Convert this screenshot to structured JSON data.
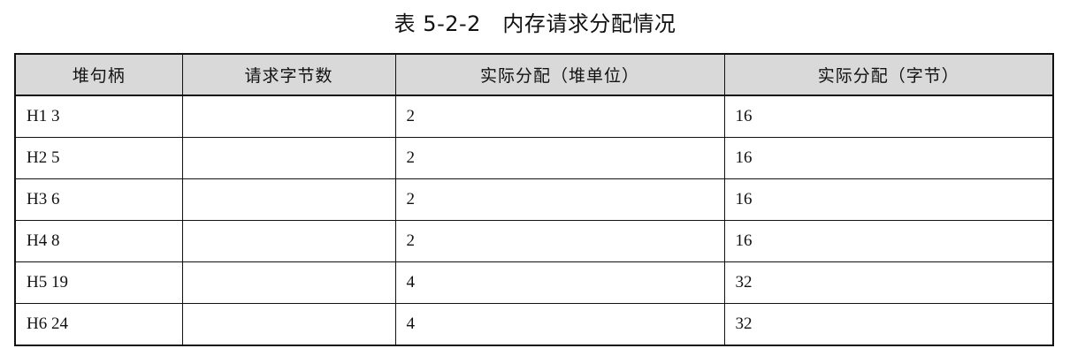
{
  "table": {
    "caption": "表 5-2-2   内存请求分配情况",
    "headers": [
      "堆句柄",
      "请求字节数",
      "实际分配（堆单位）",
      "实际分配（字节）"
    ],
    "rows": [
      [
        "H1 3",
        "",
        "2",
        "16"
      ],
      [
        "H2 5",
        "",
        "2",
        "16"
      ],
      [
        "H3 6",
        "",
        "2",
        "16"
      ],
      [
        "H4 8",
        "",
        "2",
        "16"
      ],
      [
        "H5 19",
        "",
        "4",
        "32"
      ],
      [
        "H6 24",
        "",
        "4",
        "32"
      ]
    ]
  }
}
